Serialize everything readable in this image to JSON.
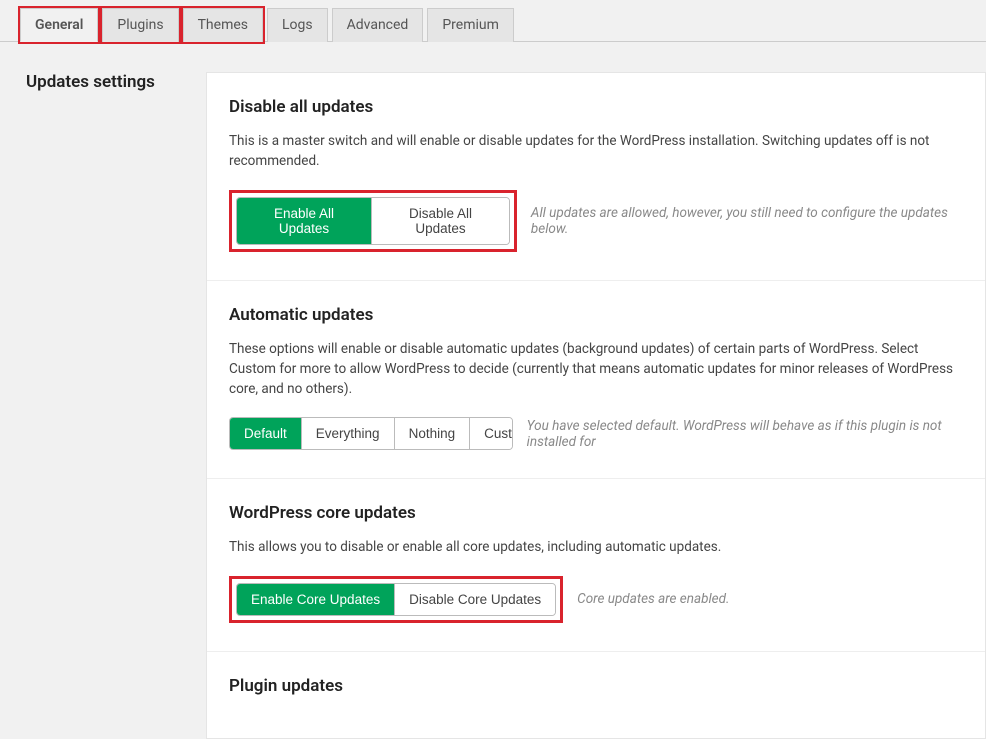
{
  "tabs": {
    "general": "General",
    "plugins": "Plugins",
    "themes": "Themes",
    "logs": "Logs",
    "advanced": "Advanced",
    "premium": "Premium"
  },
  "sidebar": {
    "title": "Updates settings"
  },
  "sections": {
    "disable_all": {
      "heading": "Disable all updates",
      "desc": "This is a master switch and will enable or disable updates for the WordPress installation. Switching updates off is not recommended.",
      "btn_enable": "Enable All Updates",
      "btn_disable": "Disable All Updates",
      "hint": "All updates are allowed, however, you still need to configure the updates below."
    },
    "automatic": {
      "heading": "Automatic updates",
      "desc": "These options will enable or disable automatic updates (background updates) of certain parts of WordPress. Select Custom for more to allow WordPress to decide (currently that means automatic updates for minor releases of WordPress core, and no others).",
      "btn_default": "Default",
      "btn_everything": "Everything",
      "btn_nothing": "Nothing",
      "btn_custom": "Custom",
      "hint": "You have selected default. WordPress will behave as if this plugin is not installed for"
    },
    "core": {
      "heading": "WordPress core updates",
      "desc": "This allows you to disable or enable all core updates, including automatic updates.",
      "btn_enable": "Enable Core Updates",
      "btn_disable": "Disable Core Updates",
      "hint": "Core updates are enabled."
    },
    "plugin": {
      "heading": "Plugin updates"
    }
  }
}
